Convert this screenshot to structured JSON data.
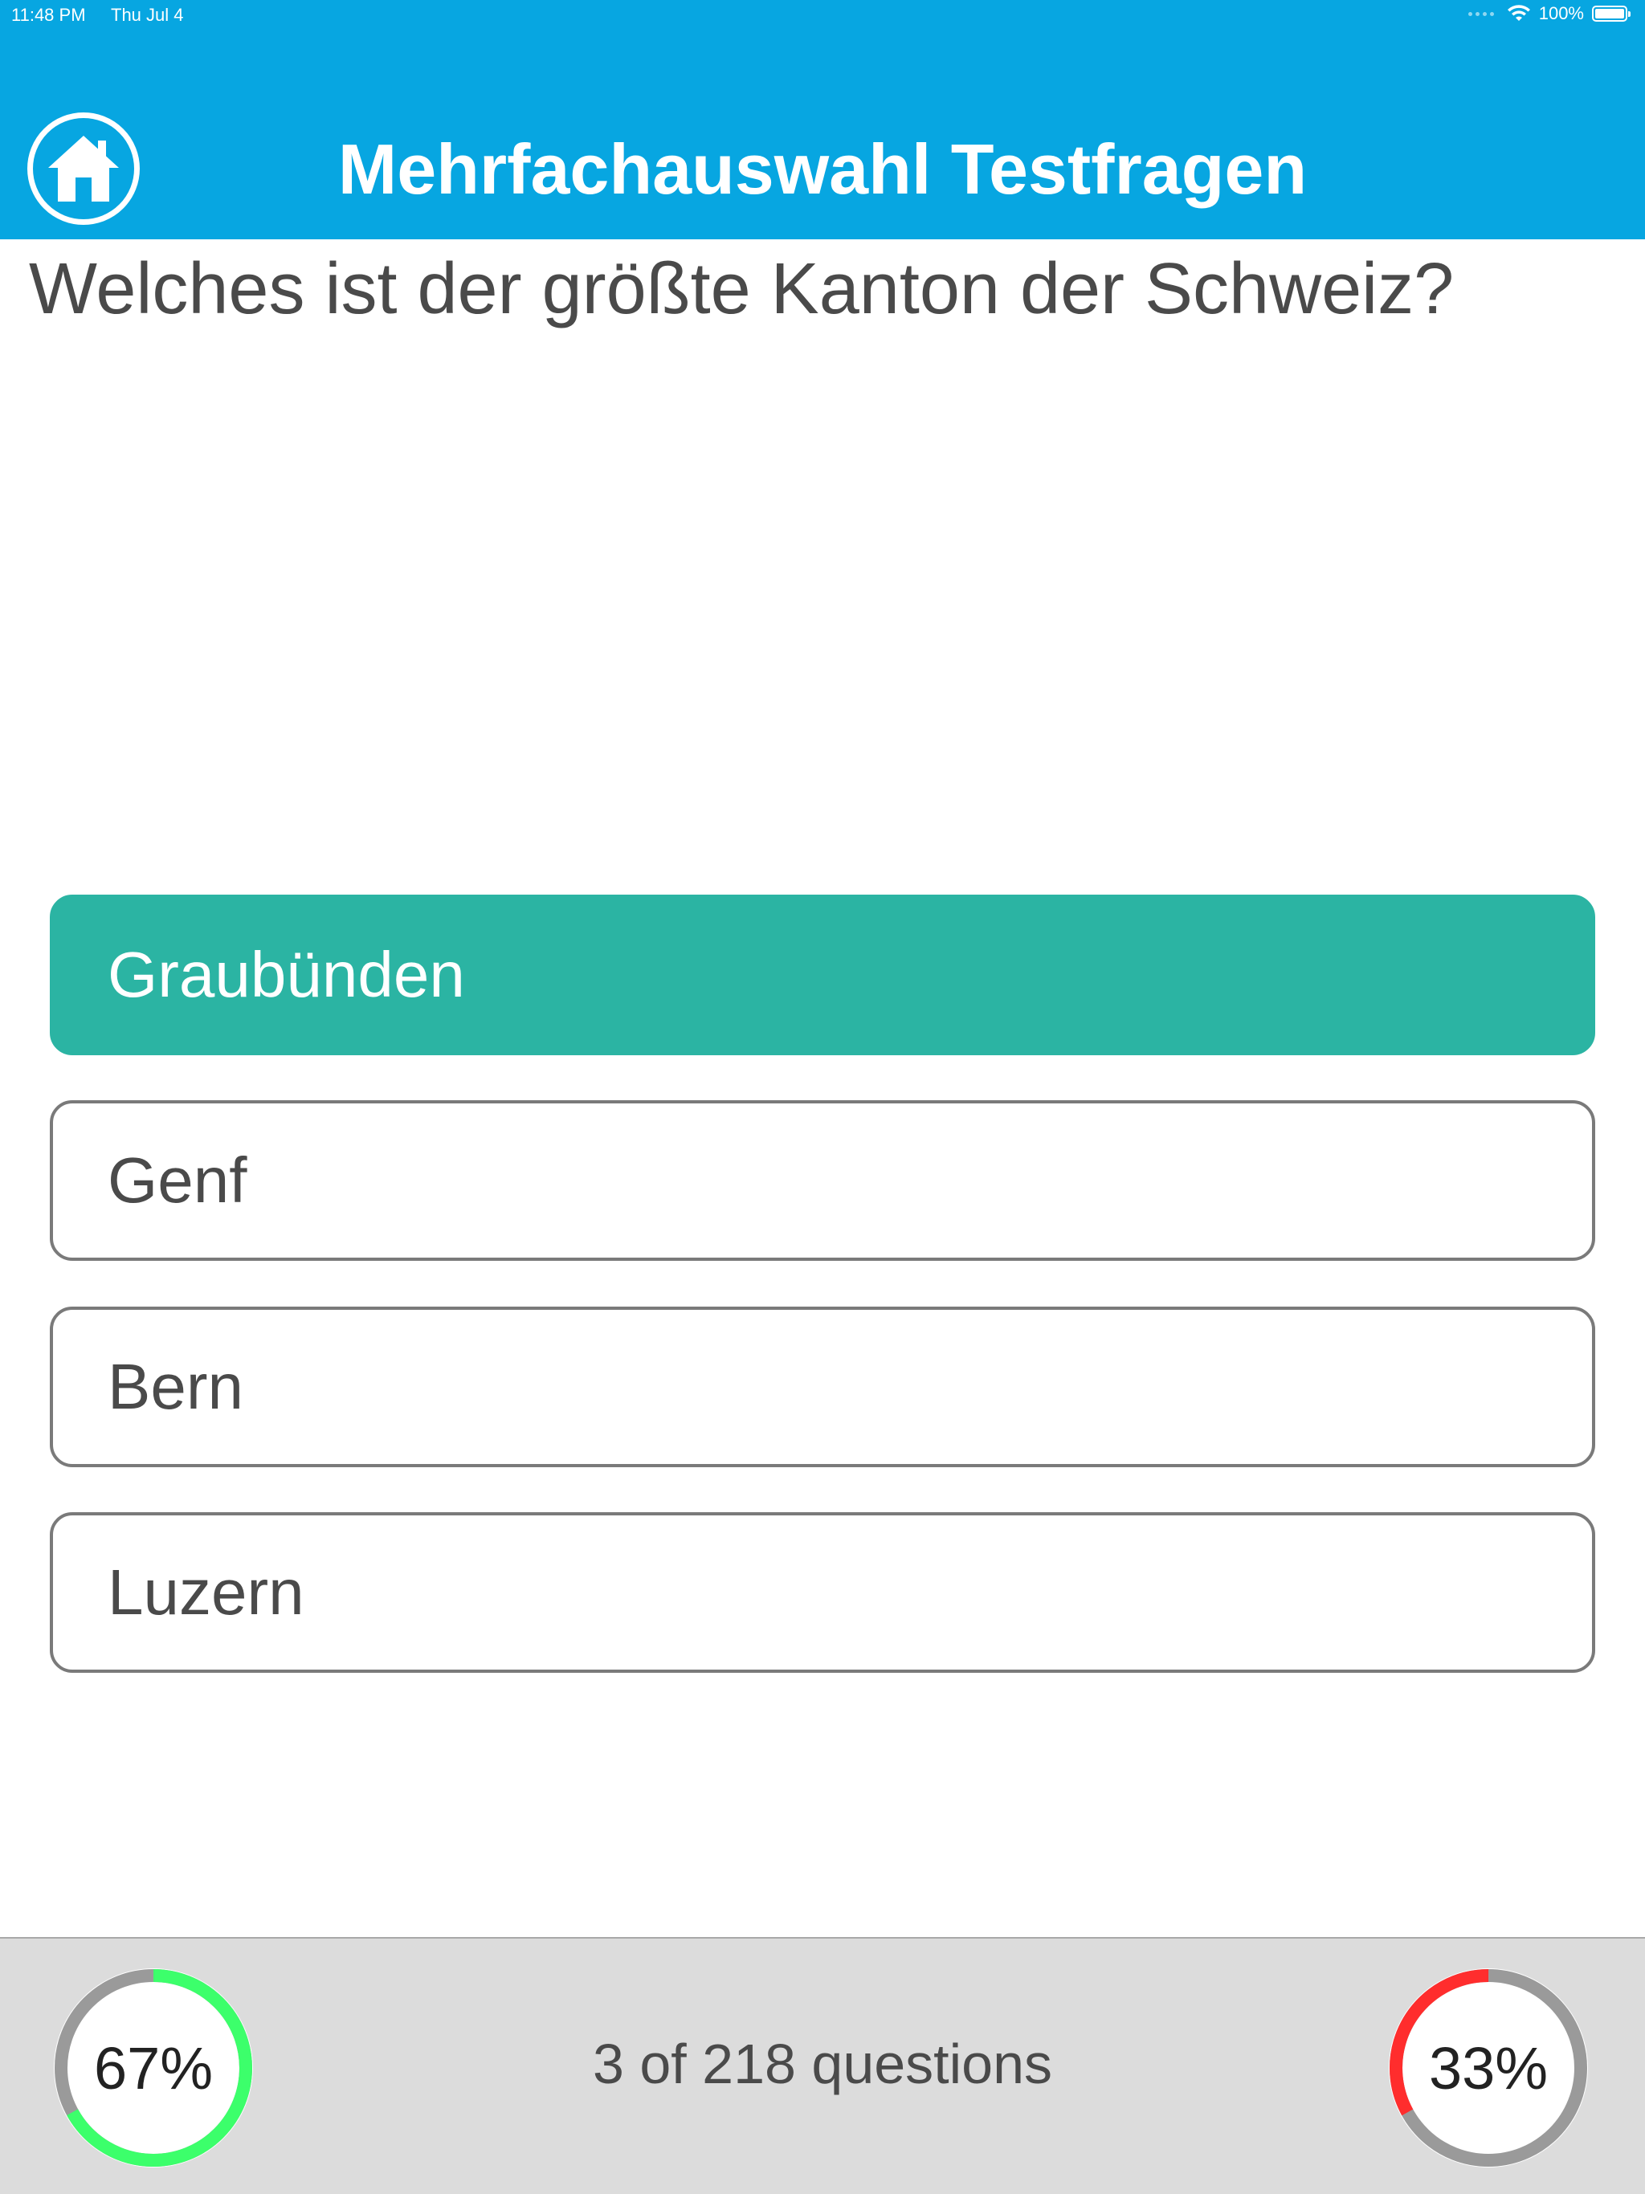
{
  "status_bar": {
    "time": "11:48 PM",
    "date": "Thu Jul 4",
    "battery": "100%"
  },
  "header": {
    "title": "Mehrfachauswahl Testfragen",
    "home_icon": "home-icon"
  },
  "question": {
    "text": "Welches ist der größte Kanton der Schweiz?"
  },
  "answers": [
    {
      "label": "Graubünden",
      "state": "correct"
    },
    {
      "label": "Genf",
      "state": "default"
    },
    {
      "label": "Bern",
      "state": "default"
    },
    {
      "label": "Luzern",
      "state": "default"
    }
  ],
  "footer": {
    "correct_percent_label": "67%",
    "correct_fraction": 0.67,
    "progress_text": "3 of 218 questions",
    "wrong_percent_label": "33%",
    "wrong_fraction": 0.33
  },
  "colors": {
    "header_bg": "#07a6e1",
    "correct_answer_bg": "#2bb4a3",
    "ring_correct": "#3cff6b",
    "ring_wrong": "#ff2d2d",
    "ring_track": "#9a9a9a"
  }
}
